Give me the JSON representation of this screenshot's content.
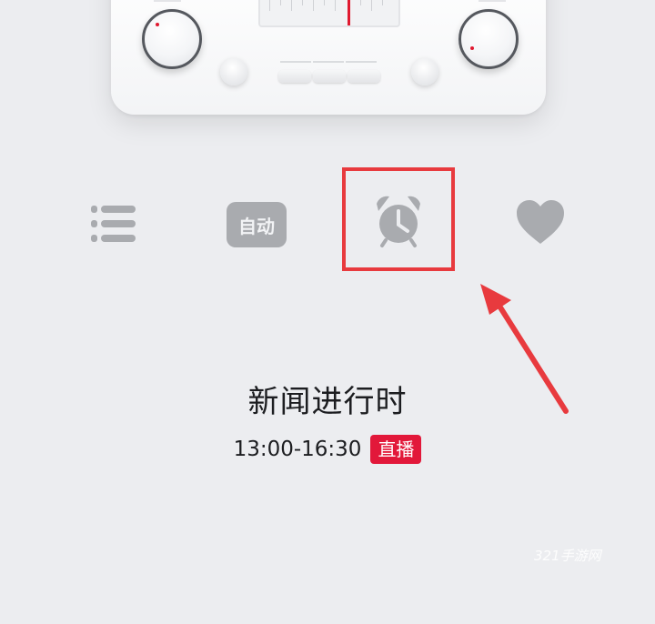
{
  "controls": {
    "list_icon": "list-icon",
    "auto_label": "自动",
    "alarm_icon": "alarm-clock-icon",
    "favorite_icon": "heart-icon"
  },
  "program": {
    "title": "新闻进行时",
    "time": "13:00-16:30",
    "live_badge": "直播"
  },
  "watermark": "321手游网",
  "colors": {
    "accent_red": "#e2183a",
    "highlight_box": "#e83a3e",
    "icon_gray": "#a9abaf",
    "background": "#ecedf0"
  }
}
